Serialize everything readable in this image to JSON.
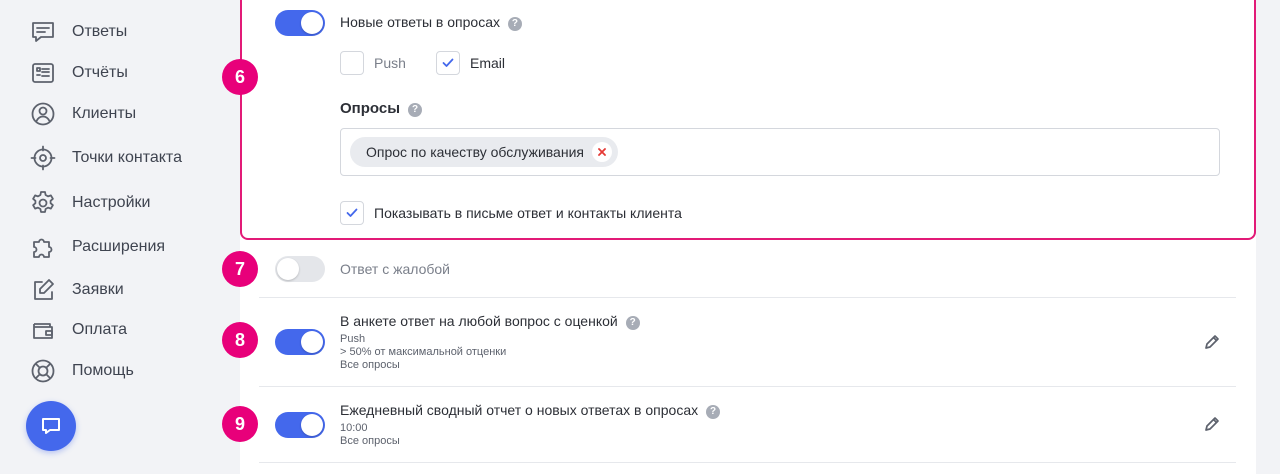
{
  "sidebar": {
    "items": [
      {
        "label": "Ответы",
        "icon": "chat-lines-icon"
      },
      {
        "label": "Отчёты",
        "icon": "report-list-icon"
      },
      {
        "label": "Клиенты",
        "icon": "user-circle-icon"
      },
      {
        "label": "Точки контакта",
        "icon": "crosshair-icon"
      },
      {
        "label": "Настройки",
        "icon": "gear-icon"
      },
      {
        "label": "Расширения",
        "icon": "puzzle-icon"
      },
      {
        "label": "Заявки",
        "icon": "edit-square-icon"
      },
      {
        "label": "Оплата",
        "icon": "wallet-icon"
      },
      {
        "label": "Помощь",
        "icon": "lifebuoy-icon"
      }
    ],
    "chat_button_icon": "chat-bubble-icon"
  },
  "colors": {
    "accent": "#4468ec",
    "badge": "#e8007a",
    "highlight_border": "#e21a77",
    "remove_x": "#e53935"
  },
  "rules": {
    "new_responses": {
      "badge": "6",
      "enabled": true,
      "title": "Новые ответы в опросах",
      "push_label": "Push",
      "push_checked": false,
      "email_label": "Email",
      "email_checked": true,
      "surveys_label": "Опросы",
      "surveys_selected": [
        "Опрос по качеству обслуживания"
      ],
      "show_in_email_label": "Показывать в письме ответ и контакты клиента",
      "show_in_email_checked": true
    },
    "complaint": {
      "badge": "7",
      "enabled": false,
      "title": "Ответ с жалобой"
    },
    "rating_answer": {
      "badge": "8",
      "enabled": true,
      "title": "В анкете ответ на любой вопрос с оценкой",
      "line1": "Push",
      "line2": "> 50% от максимальной отценки",
      "line3": "Все опросы"
    },
    "daily_report": {
      "badge": "9",
      "enabled": true,
      "title": "Ежедневный сводный отчет о новых ответах в опросах",
      "line1": "10:00",
      "line2": "Все опросы"
    }
  }
}
